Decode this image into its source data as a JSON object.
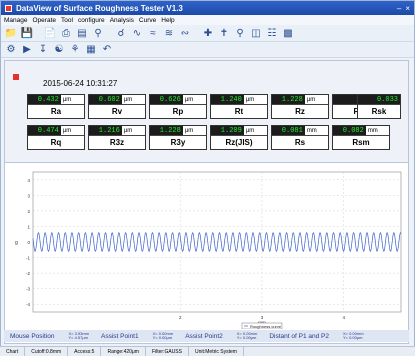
{
  "window": {
    "title": "DataView of Surface Roughness Tester  V1.3",
    "controls": [
      "–",
      "×"
    ]
  },
  "menu": [
    "Manage",
    "Operate",
    "Tool",
    "configure",
    "Analysis",
    "Curve",
    "Help"
  ],
  "toolbar1_icons": [
    "open-folder-icon",
    "save-icon",
    "document-icon",
    "print-icon",
    "print-preview-icon",
    "zoom-icon",
    "curve-icon",
    "curve2-icon",
    "curve3-icon",
    "cross-icon",
    "cross2-icon",
    "magnify-icon",
    "data-icon",
    "display-icon"
  ],
  "toolbar2_icons": [
    "calibrate-icon",
    "play-icon",
    "down-icon",
    "measure-icon",
    "settings-icon",
    "grid-icon",
    "undo-icon"
  ],
  "measurement": {
    "datetime": "2015-06-24  10:31:27",
    "row1": [
      {
        "value": "0.432",
        "unit": "μm",
        "name": "Ra"
      },
      {
        "value": "0.602",
        "unit": "μm",
        "name": "Rv"
      },
      {
        "value": "0.626",
        "unit": "μm",
        "name": "Rp"
      },
      {
        "value": "1.240",
        "unit": "μm",
        "name": "Rt"
      },
      {
        "value": "1.228",
        "unit": "μm",
        "name": "Rz"
      },
      {
        "value": "1.394",
        "unit": "",
        "name": "Rku"
      },
      {
        "value": "0.033",
        "unit": "",
        "name": "Rsk"
      }
    ],
    "row2": [
      {
        "value": "0.474",
        "unit": "μm",
        "name": "Rq"
      },
      {
        "value": "1.216",
        "unit": "μm",
        "name": "R3z"
      },
      {
        "value": "1.228",
        "unit": "μm",
        "name": "R3y"
      },
      {
        "value": "1.209",
        "unit": "μm",
        "name": "Rz(JIS)"
      },
      {
        "value": "0.081",
        "unit": "mm",
        "name": "Rs"
      },
      {
        "value": "0.082",
        "unit": "mm",
        "name": "Rsm"
      }
    ]
  },
  "chart_data": {
    "type": "line",
    "y_axis_label": "g",
    "x_axis_label": "mm",
    "y_ticks": [
      "4",
      "3",
      "2",
      "1",
      "0",
      "-1",
      "-2",
      "-3",
      "-4"
    ],
    "x_ticks": [
      "2",
      "3",
      "4"
    ],
    "ylim": [
      -4.5,
      4.5
    ],
    "xlim": [
      0.2,
      4.7
    ],
    "legend": "Roughness curve",
    "series": [
      {
        "amplitude": 0.6,
        "period": 0.082,
        "offset": 0
      }
    ],
    "grid": true
  },
  "status_line": {
    "mouse_label": "Mouse Position",
    "mouse_x": "X= 3.93mm",
    "mouse_y": "Y= 4.57μm",
    "p1_label": "Assist Point1",
    "p1_x": "X= 0.00mm",
    "p1_y": "Y= 0.00μm",
    "p2_label": "Assist Point2",
    "p2_x": "X= 0.00mm",
    "p2_y": "Y= 0.00μm",
    "dist_label": "Distant of P1 and P2",
    "dist_x": "X= 0.00mm",
    "dist_y": "Y= 0.00μm"
  },
  "status_bar": [
    "Chart",
    "Cutoff:0.8mm",
    "Access:5",
    "Range:420μm",
    "Filter:GAUSS",
    "Unit:Metric System"
  ]
}
